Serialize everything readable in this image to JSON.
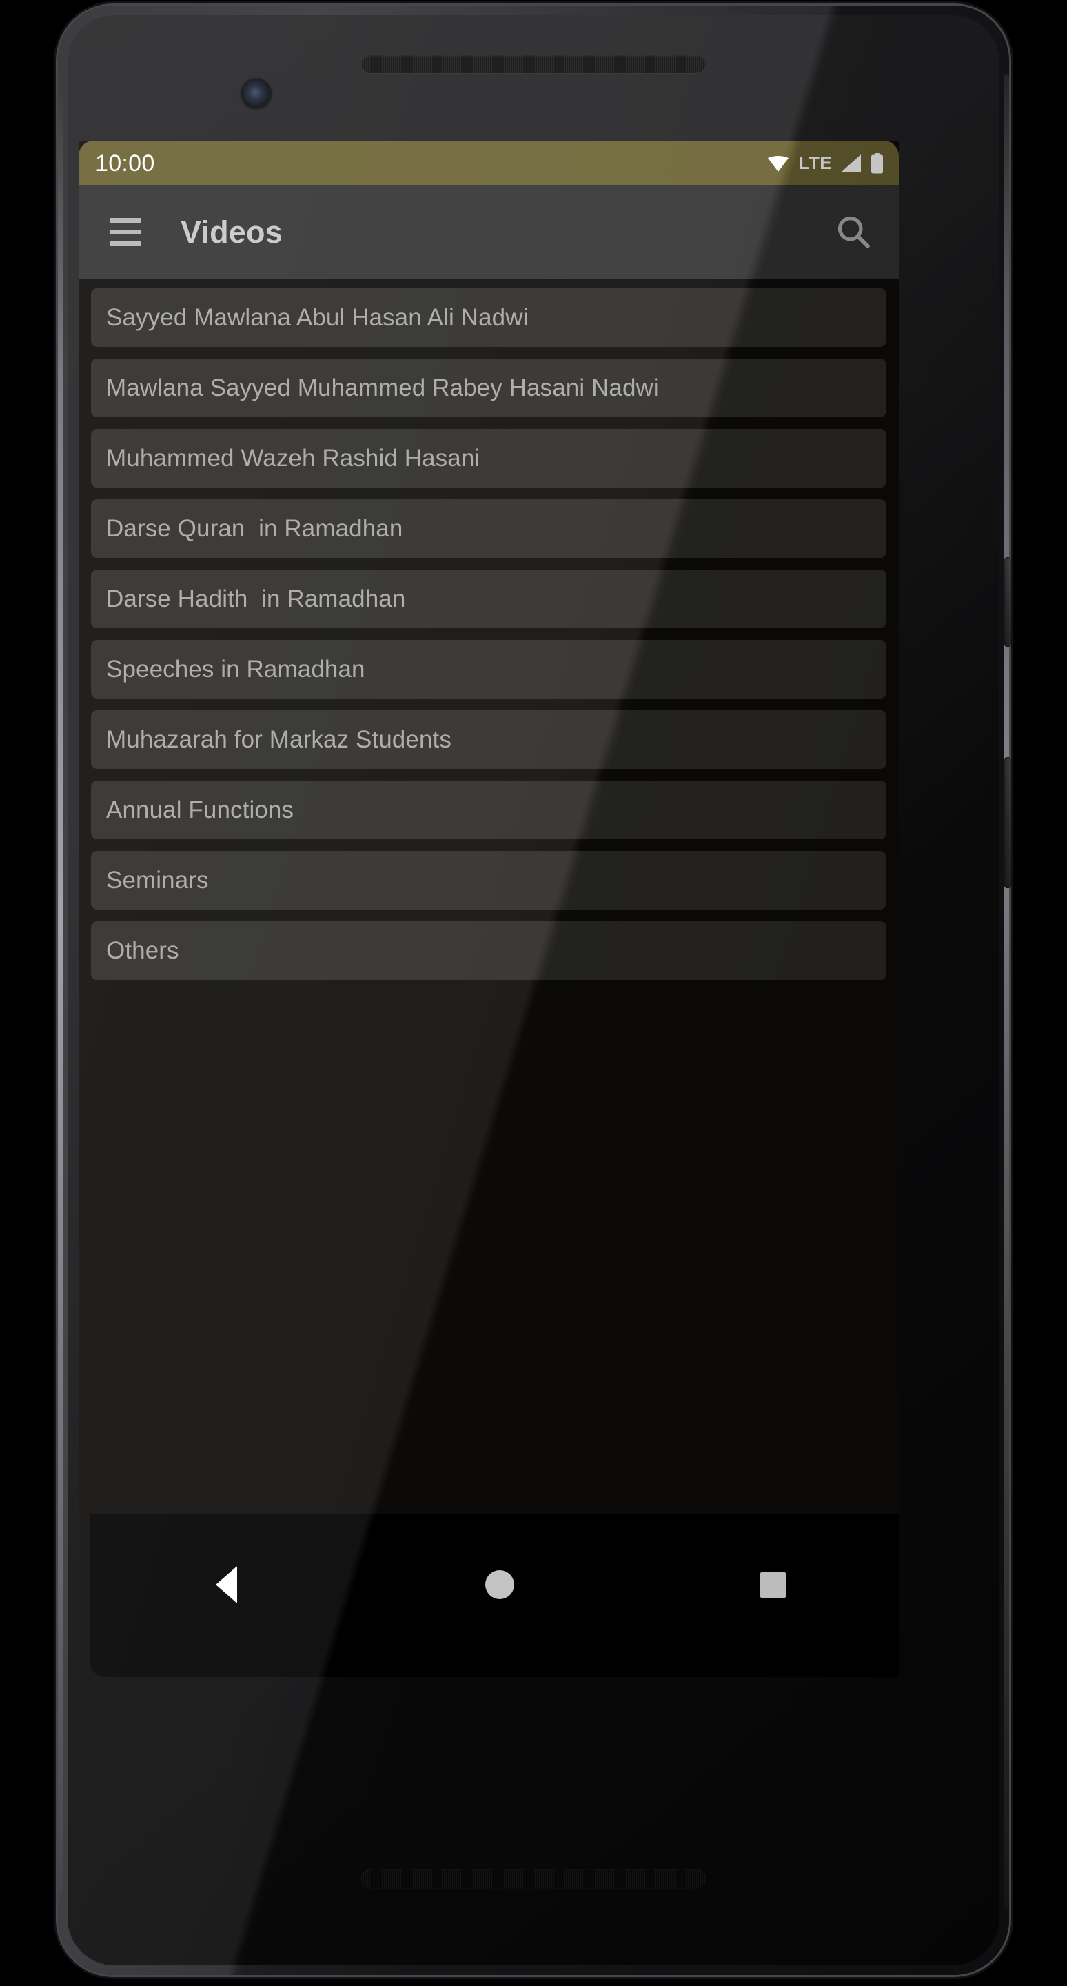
{
  "status_bar": {
    "time": "10:00",
    "network_label": "LTE",
    "icons": [
      "wifi-icon",
      "signal-icon",
      "battery-icon"
    ],
    "background_color": "#6b6333",
    "text_color": "#ffffff"
  },
  "app_bar": {
    "title": "Videos",
    "menu_icon": "hamburger-menu-icon",
    "search_icon": "search-icon",
    "background_color": "#333333",
    "title_color": "#c8c8c6"
  },
  "list": {
    "items": [
      {
        "label": "Sayyed Mawlana Abul Hasan Ali Nadwi"
      },
      {
        "label": "Mawlana Sayyed Muhammed Rabey Hasani Nadwi"
      },
      {
        "label": "Muhammed Wazeh Rashid Hasani"
      },
      {
        "label": "Darse Quran  in Ramadhan"
      },
      {
        "label": "Darse Hadith  in Ramadhan"
      },
      {
        "label": "Speeches in Ramadhan"
      },
      {
        "label": "Muhazarah for Markaz Students"
      },
      {
        "label": "Annual Functions"
      },
      {
        "label": "Seminars"
      },
      {
        "label": "Others"
      }
    ],
    "item_background_color": "#2c2b29",
    "item_text_color": "#a8a7a3",
    "screen_background_color": "#0e0c0a"
  },
  "nav_bar": {
    "back_icon": "back-triangle-icon",
    "home_icon": "home-circle-icon",
    "recents_icon": "recents-square-icon",
    "background_color": "#000000"
  },
  "device": {
    "earpiece": "earpiece-speaker",
    "front_camera": "front-camera",
    "bottom_speaker": "bottom-speaker",
    "power_button": "power-button",
    "volume_button": "volume-button"
  }
}
